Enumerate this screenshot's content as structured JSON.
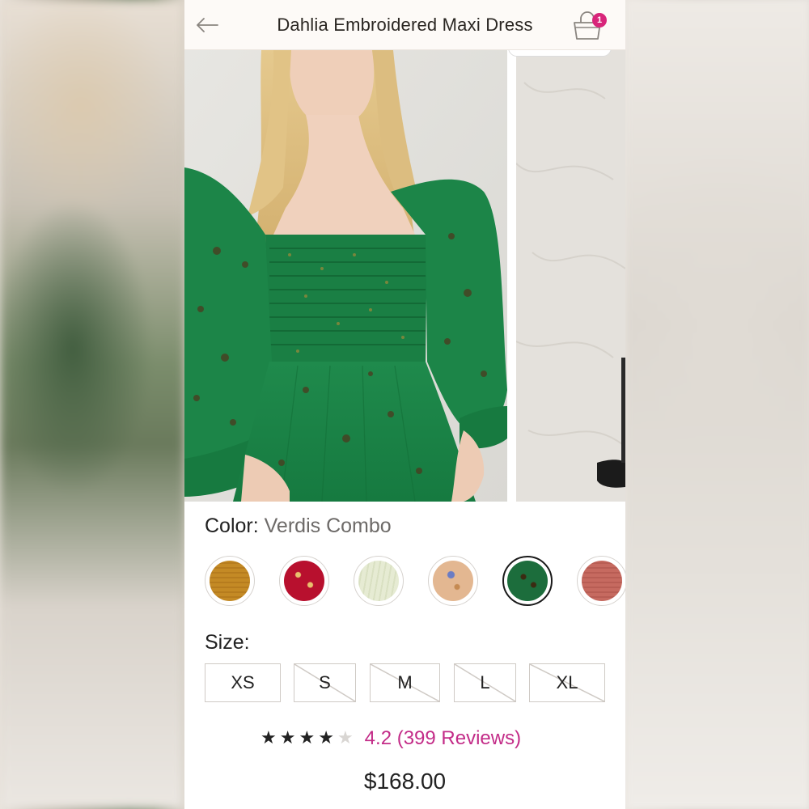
{
  "header": {
    "title": "Dahlia Embroidered Maxi Dress",
    "back_icon": "arrow-left-icon",
    "bag_icon": "shopping-bag-icon",
    "bag_count": "1",
    "badge_color": "#d8257a"
  },
  "gallery": {
    "images": [
      "model-in-green-dress",
      "model-on-textured-backdrop"
    ]
  },
  "color": {
    "label": "Color:",
    "selected": "Verdis Combo",
    "swatches": [
      {
        "name": "mustard",
        "color": "#c48a25"
      },
      {
        "name": "red",
        "color": "#b8102e"
      },
      {
        "name": "cream",
        "color": "#e6ebd3"
      },
      {
        "name": "peach",
        "color": "#e3b791"
      },
      {
        "name": "verdis-combo",
        "color": "#1c6d3c",
        "selected": true
      },
      {
        "name": "rose",
        "color": "#c66a60"
      }
    ]
  },
  "size": {
    "label": "Size:",
    "options": [
      {
        "label": "XS",
        "available": true
      },
      {
        "label": "S",
        "available": false
      },
      {
        "label": "M",
        "available": false
      },
      {
        "label": "L",
        "available": false
      },
      {
        "label": "XL",
        "available": false
      }
    ]
  },
  "rating": {
    "stars": 4,
    "max_stars": 5,
    "text": "4.2 (399 Reviews)",
    "accent": "#c32c88"
  },
  "price": "$168.00"
}
